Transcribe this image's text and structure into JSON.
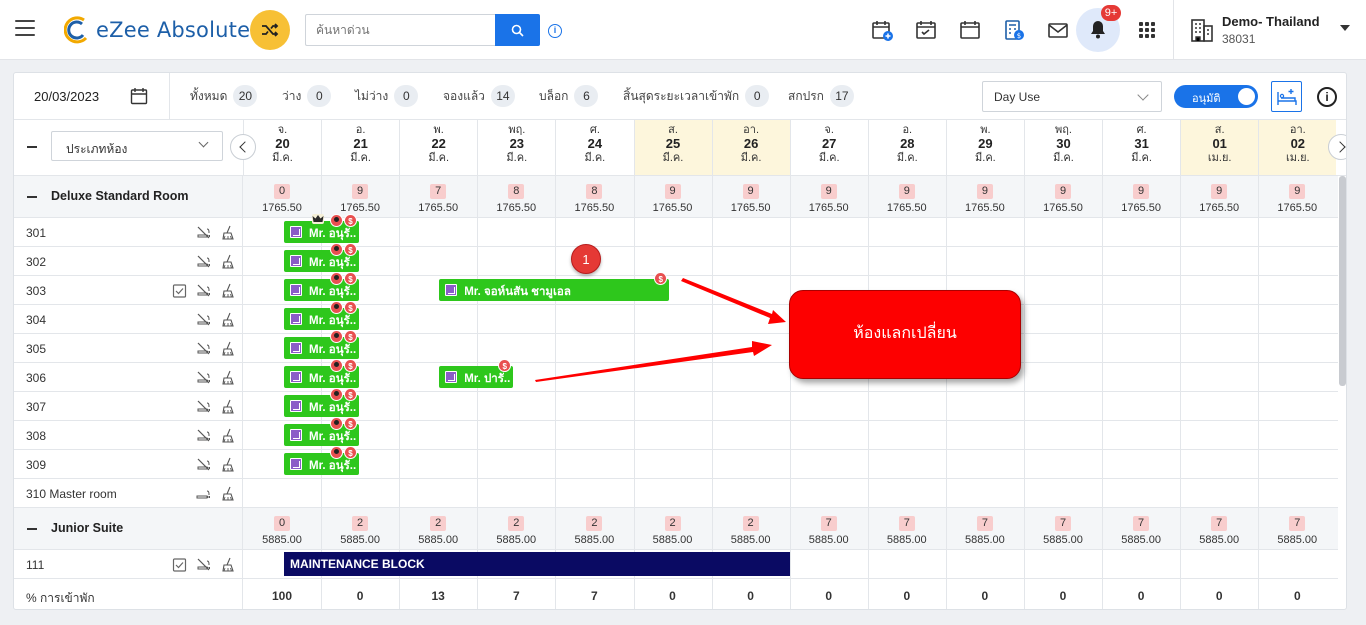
{
  "app": {
    "name": "eZee Absolute"
  },
  "search": {
    "placeholder": "ค้นหาด่วน"
  },
  "notifications": {
    "badge": "9+"
  },
  "hotel": {
    "name": "Demo- Thailand",
    "code": "38031"
  },
  "filters": {
    "date": "20/03/2023",
    "stats": [
      {
        "label": "ทั้งหมด",
        "count": "20"
      },
      {
        "label": "ว่าง",
        "count": "0"
      },
      {
        "label": "ไม่ว่าง",
        "count": "0"
      },
      {
        "label": "จองแล้ว",
        "count": "14"
      },
      {
        "label": "บล็อก",
        "count": "6"
      },
      {
        "label": "สิ้นสุดระยะเวลาเข้าพัก",
        "count": "0"
      },
      {
        "label": "สกปรก",
        "count": "17"
      }
    ],
    "view_select": "Day Use",
    "toggle_label": "อนุมัติ"
  },
  "room_type_select": "ประเภทห้อง",
  "dates": [
    {
      "dow": "จ.",
      "day": "20",
      "month": "มี.ค.",
      "weekend": false
    },
    {
      "dow": "อ.",
      "day": "21",
      "month": "มี.ค.",
      "weekend": false
    },
    {
      "dow": "พ.",
      "day": "22",
      "month": "มี.ค.",
      "weekend": false
    },
    {
      "dow": "พฤ.",
      "day": "23",
      "month": "มี.ค.",
      "weekend": false
    },
    {
      "dow": "ศ.",
      "day": "24",
      "month": "มี.ค.",
      "weekend": false
    },
    {
      "dow": "ส.",
      "day": "25",
      "month": "มี.ค.",
      "weekend": true
    },
    {
      "dow": "อา.",
      "day": "26",
      "month": "มี.ค.",
      "weekend": true
    },
    {
      "dow": "จ.",
      "day": "27",
      "month": "มี.ค.",
      "weekend": false
    },
    {
      "dow": "อ.",
      "day": "28",
      "month": "มี.ค.",
      "weekend": false
    },
    {
      "dow": "พ.",
      "day": "29",
      "month": "มี.ค.",
      "weekend": false
    },
    {
      "dow": "พฤ.",
      "day": "30",
      "month": "มี.ค.",
      "weekend": false
    },
    {
      "dow": "ศ.",
      "day": "31",
      "month": "มี.ค.",
      "weekend": false
    },
    {
      "dow": "ส.",
      "day": "01",
      "month": "เม.ย.",
      "weekend": true
    },
    {
      "dow": "อา.",
      "day": "02",
      "month": "เม.ย.",
      "weekend": true
    }
  ],
  "sections": [
    {
      "name": "Deluxe Standard Room",
      "availability": [
        "0",
        "9",
        "7",
        "8",
        "8",
        "9",
        "9",
        "9",
        "9",
        "9",
        "9",
        "9",
        "9",
        "9"
      ],
      "prices": [
        "1765.50",
        "1765.50",
        "1765.50",
        "1765.50",
        "1765.50",
        "1765.50",
        "1765.50",
        "1765.50",
        "1765.50",
        "1765.50",
        "1765.50",
        "1765.50",
        "1765.50",
        "1765.50"
      ],
      "rooms": [
        "301",
        "302",
        "303",
        "304",
        "305",
        "306",
        "307",
        "308",
        "309",
        "310 Master room"
      ]
    },
    {
      "name": "Junior Suite",
      "availability": [
        "0",
        "2",
        "2",
        "2",
        "2",
        "2",
        "2",
        "7",
        "7",
        "7",
        "7",
        "7",
        "7",
        "7"
      ],
      "prices": [
        "5885.00",
        "5885.00",
        "5885.00",
        "5885.00",
        "5885.00",
        "5885.00",
        "5885.00",
        "5885.00",
        "5885.00",
        "5885.00",
        "5885.00",
        "5885.00",
        "5885.00",
        "5885.00"
      ],
      "rooms": [
        "111"
      ]
    }
  ],
  "bookings": {
    "short_name": "Mr. อนุรั...",
    "long_name": "Mr. จอห์นสัน ชามูเอล",
    "mid_name": "Mr. ปารั...",
    "maintenance": "MAINTENANCE BLOCK"
  },
  "occupancy": {
    "label": "% การเข้าพัก",
    "values": [
      "100",
      "0",
      "13",
      "7",
      "7",
      "0",
      "0",
      "0",
      "0",
      "0",
      "0",
      "0",
      "0",
      "0"
    ]
  },
  "annotation": {
    "step": "1",
    "callout": "ห้องแลกเปลี่ยน"
  }
}
